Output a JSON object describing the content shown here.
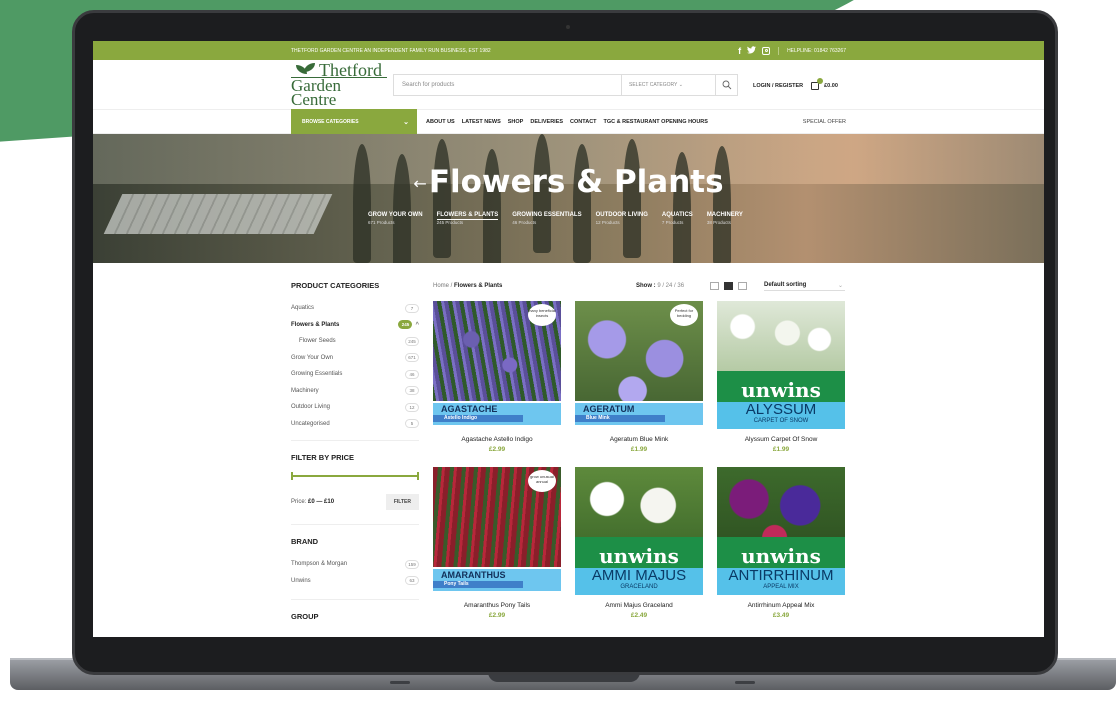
{
  "topbar": {
    "tagline": "THETFORD GARDEN CENTRE AN INDEPENDENT FAMILY RUN BUSINESS, EST 1982",
    "helpline": "HELPLINE: 01842 763267",
    "social_icons": [
      "facebook-icon",
      "twitter-icon",
      "instagram-icon"
    ]
  },
  "header": {
    "logo_line1": "Thetford",
    "logo_line2": "Garden Centre",
    "search_placeholder": "Search for products",
    "select_category": "SELECT CATEGORY",
    "login": "LOGIN / REGISTER",
    "cart_total": "£0.00",
    "cart_count": "0"
  },
  "nav": {
    "browse": "BROWSE CATEGORIES",
    "items": [
      "ABOUT US",
      "LATEST NEWS",
      "SHOP",
      "DELIVERIES",
      "CONTACT",
      "TGC & RESTAURANT OPENING HOURS"
    ],
    "special": "SPECIAL OFFER"
  },
  "hero": {
    "title": "Flowers & Plants",
    "back_arrow": "←",
    "subcats": [
      {
        "name": "GROW YOUR OWN",
        "count": "671 Products"
      },
      {
        "name": "FLOWERS & PLANTS",
        "count": "245 Products"
      },
      {
        "name": "GROWING ESSENTIALS",
        "count": "46 Products"
      },
      {
        "name": "OUTDOOR LIVING",
        "count": "12 Products"
      },
      {
        "name": "AQUATICS",
        "count": "7 Products"
      },
      {
        "name": "MACHINERY",
        "count": "38 Products"
      }
    ]
  },
  "sidebar": {
    "categories_title": "PRODUCT CATEGORIES",
    "categories": [
      {
        "name": "Aquatics",
        "count": "7"
      },
      {
        "name": "Flowers & Plants",
        "count": "245"
      },
      {
        "name": "Flower Seeds",
        "count": "245"
      },
      {
        "name": "Grow Your Own",
        "count": "671"
      },
      {
        "name": "Growing Essentials",
        "count": "46"
      },
      {
        "name": "Machinery",
        "count": "38"
      },
      {
        "name": "Outdoor Living",
        "count": "12"
      },
      {
        "name": "Uncategorised",
        "count": "5"
      }
    ],
    "filter_title": "FILTER BY PRICE",
    "price_label": "Price:",
    "price_range": "£0 — £10",
    "filter_button": "FILTER",
    "brand_title": "BRAND",
    "brands": [
      {
        "name": "Thompson & Morgan",
        "count": "159"
      },
      {
        "name": "Unwins",
        "count": "63"
      }
    ],
    "group_title": "GROUP"
  },
  "toolbar": {
    "crumb_home": "Home /",
    "crumb_current": "Flowers & Plants",
    "show_label": "Show :",
    "show_options": "9 / 24 / 36",
    "sort": "Default sorting"
  },
  "products": [
    {
      "name": "Agastache Astello Indigo",
      "price": "£2.99",
      "pack_title": "AGASTACHE",
      "pack_sub": "Astello Indigo",
      "tag": "many beneficial insects"
    },
    {
      "name": "Ageratum Blue Mink",
      "price": "£1.99",
      "pack_title": "AGERATUM",
      "pack_sub": "Blue Mink",
      "tag": "Perfect for bedding"
    },
    {
      "name": "Alyssum Carpet Of Snow",
      "price": "£1.99",
      "brand": "unwins",
      "pack_title": "ALYSSUM",
      "pack_sub": "CARPET OF SNOW"
    },
    {
      "name": "Amaranthus Pony Tails",
      "price": "£2.99",
      "pack_title": "AMARANTHUS",
      "pack_sub": "Pony Tails",
      "tag": "grow unusual annual"
    },
    {
      "name": "Ammi Majus Graceland",
      "price": "£2.49",
      "brand": "unwins",
      "pack_title": "AMMI MAJUS",
      "pack_sub": "GRACELAND"
    },
    {
      "name": "Antirrhinum Appeal Mix",
      "price": "£3.49",
      "brand": "unwins",
      "pack_title": "ANTIRRHINUM",
      "pack_sub": "APPEAL MIX"
    }
  ],
  "colors": {
    "accent": "#8aa83e",
    "brand_green": "#386b39",
    "bg_green": "#4f9a64"
  }
}
